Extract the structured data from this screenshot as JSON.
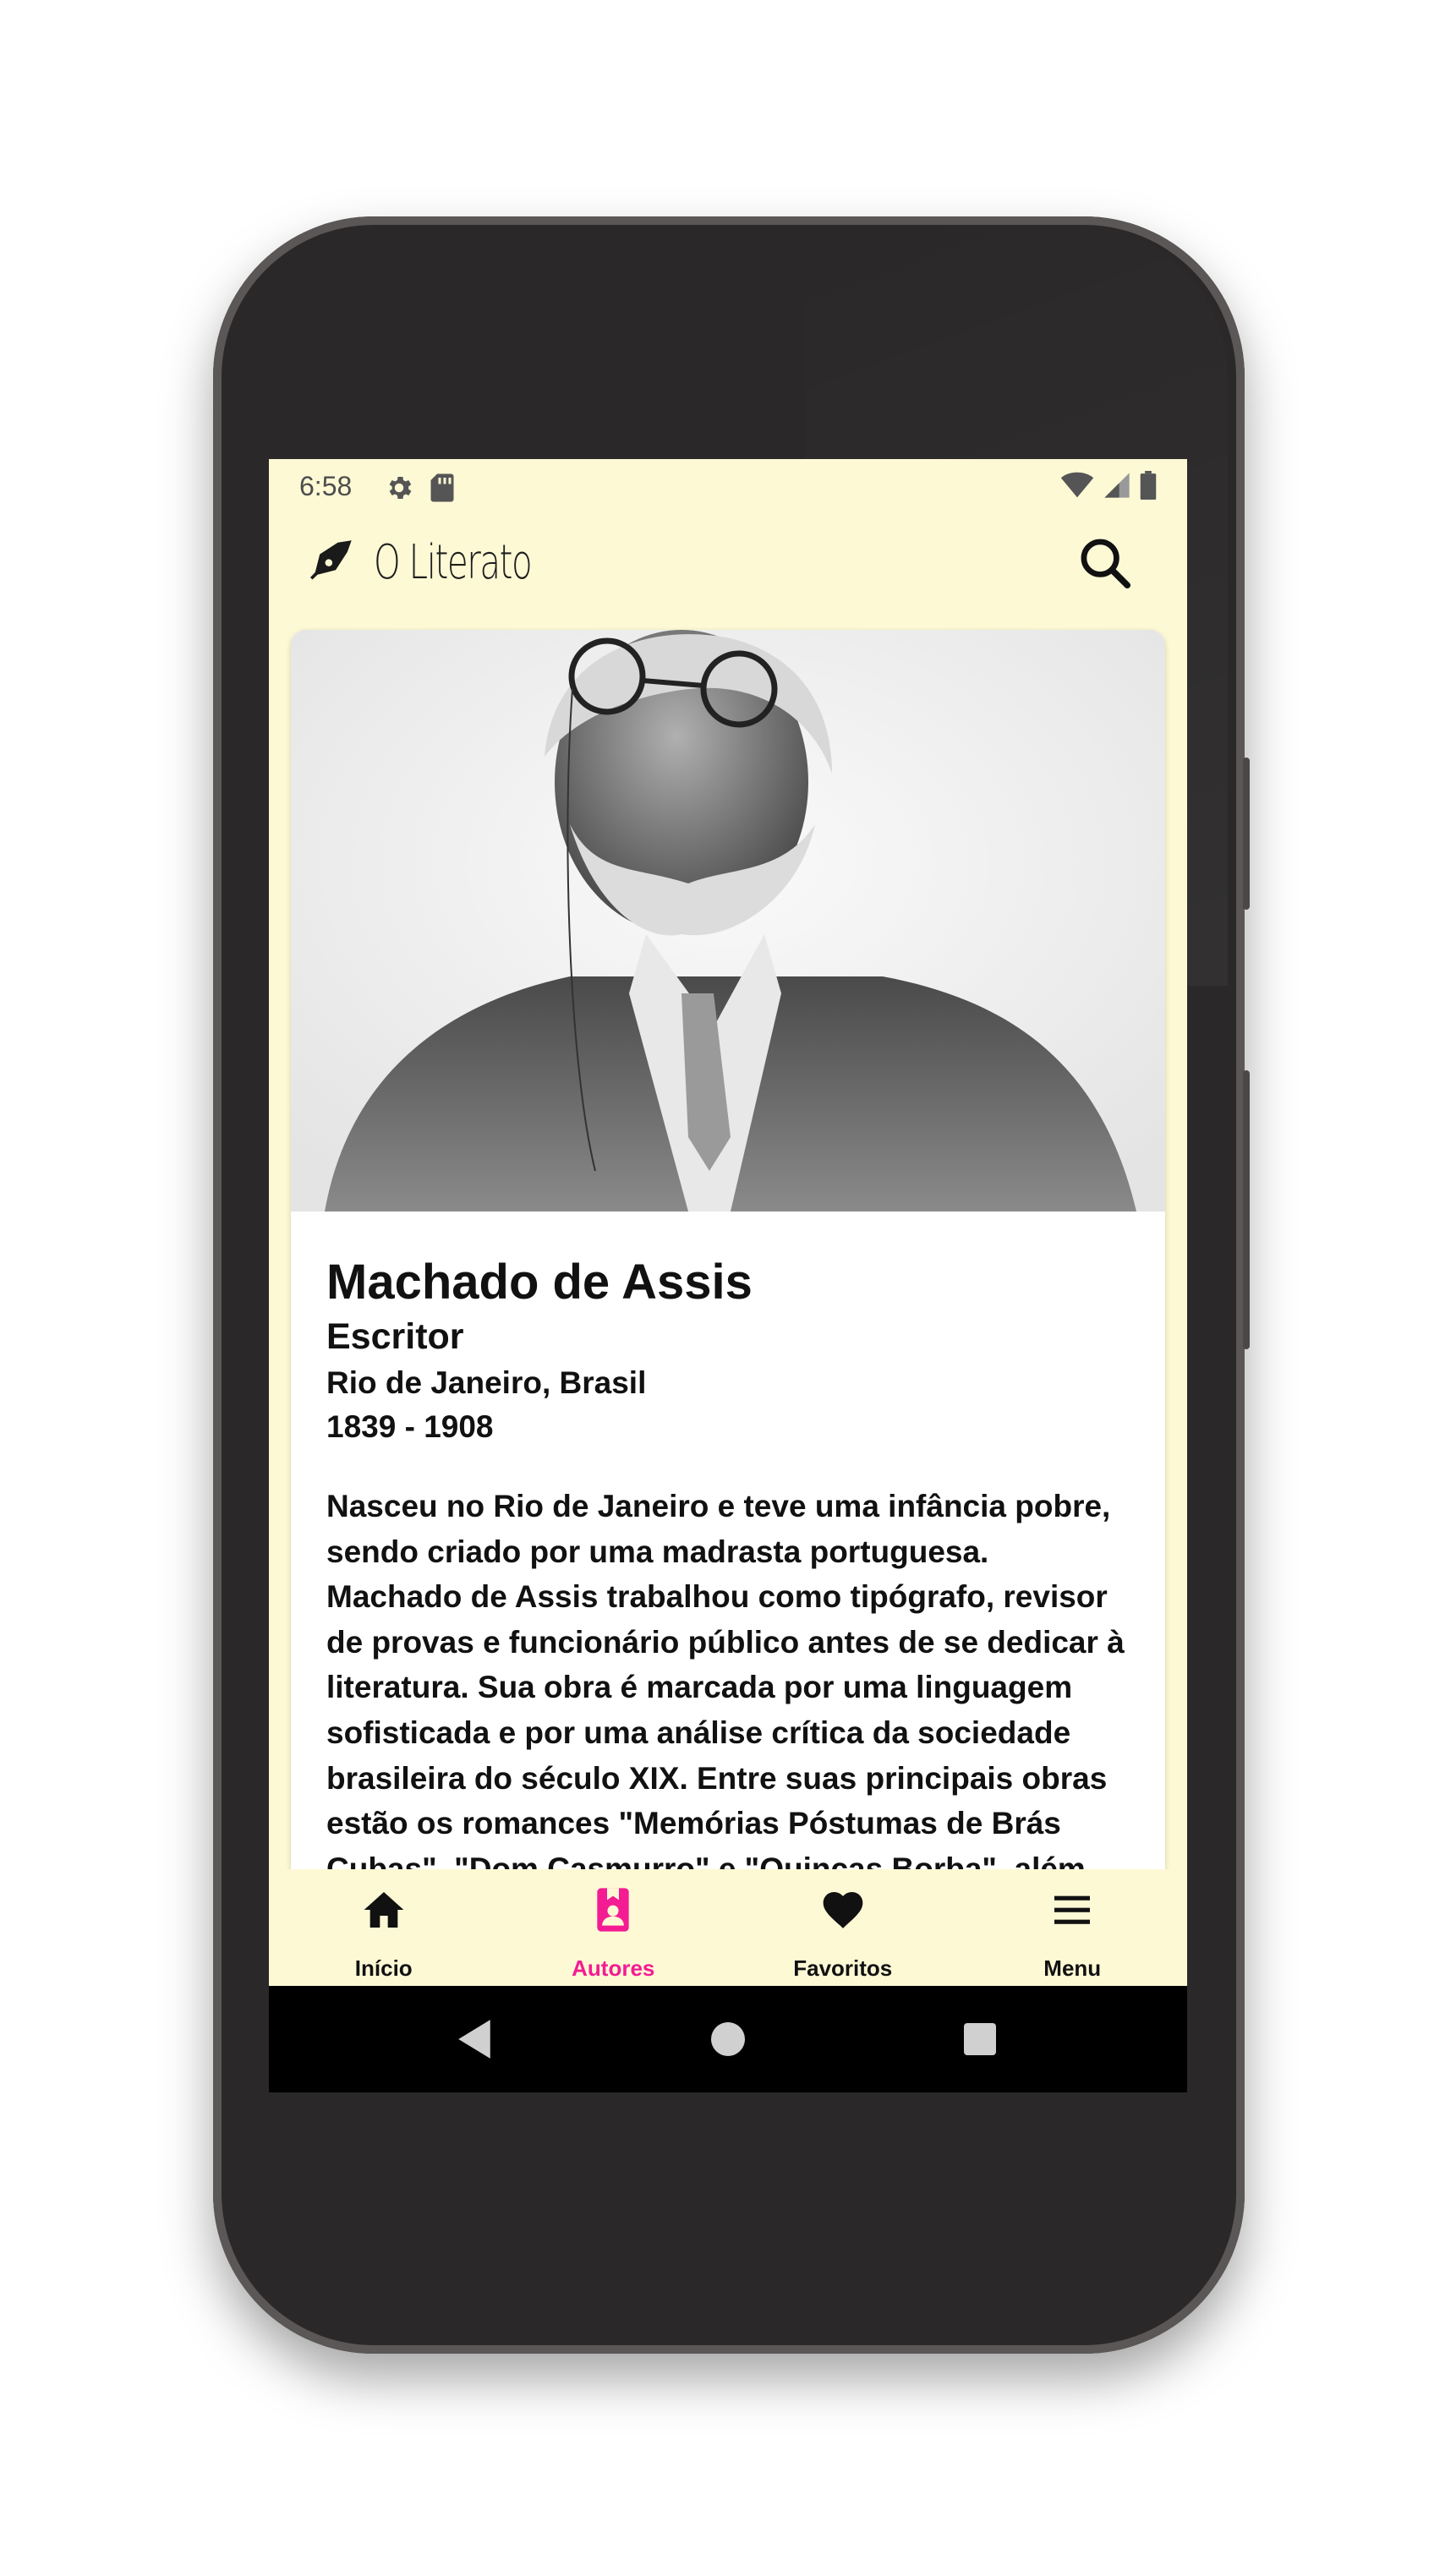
{
  "status_bar": {
    "time": "6:58"
  },
  "app_bar": {
    "title": "O Literato"
  },
  "author": {
    "name": "Machado de Assis",
    "role": "Escritor",
    "place": "Rio de Janeiro, Brasil",
    "years": "1839 - 1908",
    "bio": "Nasceu no Rio de Janeiro e teve uma infância pobre, sendo criado por uma madrasta portuguesa. Machado de Assis trabalhou como tipógrafo, revisor de provas e funcionário público antes de se dedicar à literatura. Sua obra é marcada por uma linguagem sofisticada e por uma análise crítica da sociedade brasileira do século XIX. Entre suas principais obras estão os romances \"Memórias Póstumas de Brás Cubas\", \"Dom Casmurro\" e \"Quincas Borba\", além"
  },
  "bottom_nav": {
    "items": [
      {
        "label": "Início",
        "icon": "home-icon",
        "active": false
      },
      {
        "label": "Autores",
        "icon": "authors-book-icon",
        "active": true
      },
      {
        "label": "Favoritos",
        "icon": "heart-icon",
        "active": false
      },
      {
        "label": "Menu",
        "icon": "menu-icon",
        "active": false
      }
    ]
  },
  "colors": {
    "app_background": "#fdf9d5",
    "accent": "#f41c93",
    "card": "#ffffff",
    "phone_body": "#2a2828"
  }
}
